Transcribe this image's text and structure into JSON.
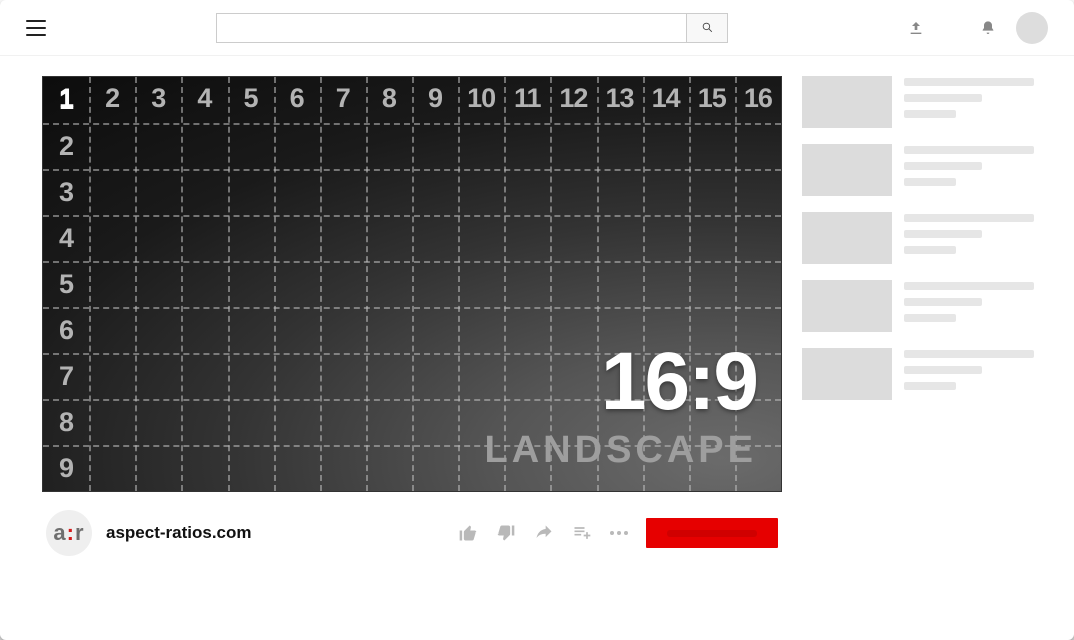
{
  "search": {
    "placeholder": ""
  },
  "video": {
    "ratio": "16:9",
    "ratio_sub": "LANDSCAPE",
    "cols": [
      "1",
      "2",
      "3",
      "4",
      "5",
      "6",
      "7",
      "8",
      "9",
      "10",
      "11",
      "12",
      "13",
      "14",
      "15",
      "16"
    ],
    "rows": [
      "1",
      "2",
      "3",
      "4",
      "5",
      "6",
      "7",
      "8",
      "9"
    ]
  },
  "channel": {
    "logo_a": "a",
    "logo_colon": ":",
    "logo_r": "r",
    "name": "aspect-ratios.com"
  },
  "subscribe_label": "",
  "sidebar_item_count": 5
}
